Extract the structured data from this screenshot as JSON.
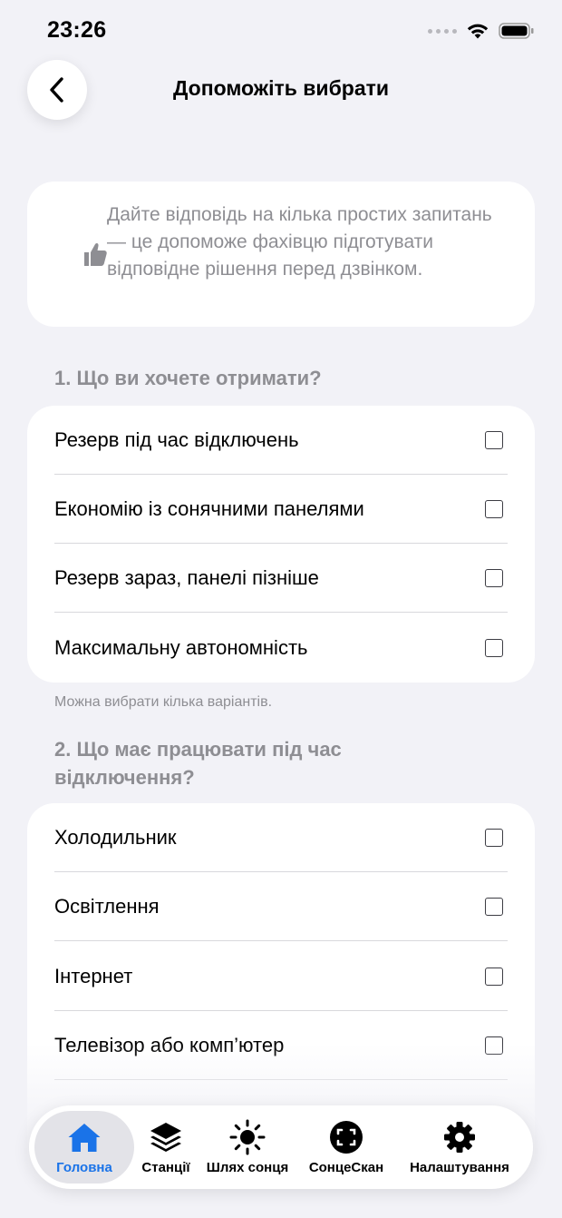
{
  "status_bar": {
    "time": "23:26"
  },
  "header": {
    "title": "Допоможіть вибрати",
    "back_icon": "chevron-left-icon"
  },
  "info_card": {
    "icon": "thumbs-up-icon",
    "text": "Дайте відповідь на кілька простих запитань — це допоможе фахівцю підготувати відповідне рішення перед дзвінком."
  },
  "question1": {
    "title": "1. Що ви хочете отримати?",
    "options": [
      {
        "label": "Резерв під час відключень",
        "checked": false
      },
      {
        "label": "Економію із сонячними панелями",
        "checked": false
      },
      {
        "label": "Резерв зараз, панелі пізніше",
        "checked": false
      },
      {
        "label": "Максимальну автономність",
        "checked": false
      }
    ],
    "hint": "Можна вибрати кілька варіантів."
  },
  "question2": {
    "title": "2. Що має працювати під час відключення?",
    "options": [
      {
        "label": "Холодильник",
        "checked": false
      },
      {
        "label": "Освітлення",
        "checked": false
      },
      {
        "label": "Інтернет",
        "checked": false
      },
      {
        "label": "Телевізор або комп’ютер",
        "checked": false
      }
    ]
  },
  "tab_bar": {
    "items": [
      {
        "label": "Головна",
        "icon": "home-icon",
        "active": true
      },
      {
        "label": "Станції",
        "icon": "layers-icon",
        "active": false
      },
      {
        "label": "Шлях сонця",
        "icon": "sun-icon",
        "active": false
      },
      {
        "label": "СонцеСкан",
        "icon": "scan-icon",
        "active": false
      },
      {
        "label": "Налаштування",
        "icon": "gear-icon",
        "active": false
      }
    ]
  },
  "colors": {
    "accent": "#1a73e8",
    "background": "#f2f2f7",
    "secondary_text": "#8e8e93"
  }
}
